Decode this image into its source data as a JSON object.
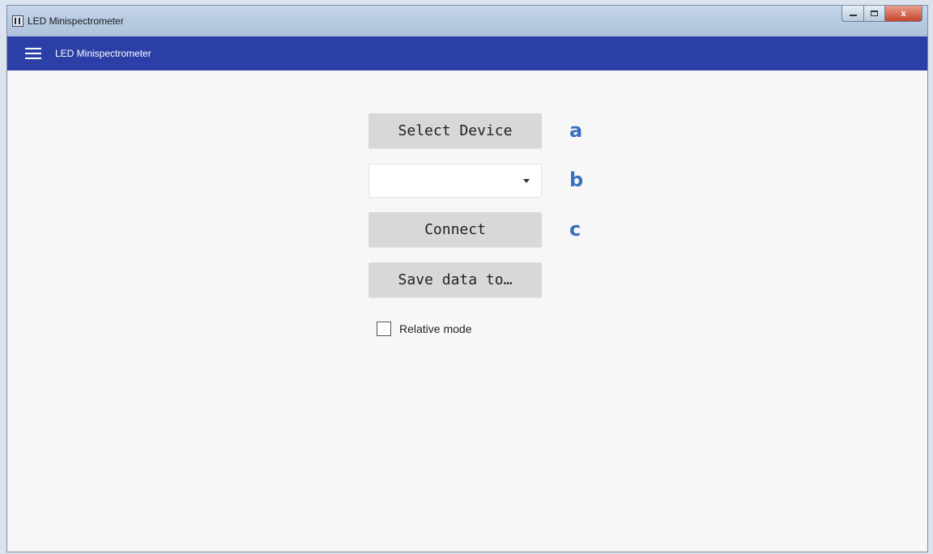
{
  "window": {
    "title": "LED Minispectrometer",
    "controls": {
      "minimize": "minimize",
      "maximize": "maximize",
      "close": "x"
    }
  },
  "appbar": {
    "title": "LED Minispectrometer",
    "menu_icon": "hamburger-menu-icon"
  },
  "main": {
    "select_device_label": "Select Device",
    "device_dropdown_value": "",
    "connect_label": "Connect",
    "save_data_label": "Save data to…",
    "relative_mode_label": "Relative mode",
    "relative_mode_checked": false
  },
  "annotations": {
    "a": "a",
    "b": "b",
    "c": "c"
  },
  "colors": {
    "appbar_bg": "#2b3fa6",
    "button_bg": "#d8d8d8",
    "annotation": "#3a6fbf",
    "content_bg": "#f7f7f7"
  }
}
